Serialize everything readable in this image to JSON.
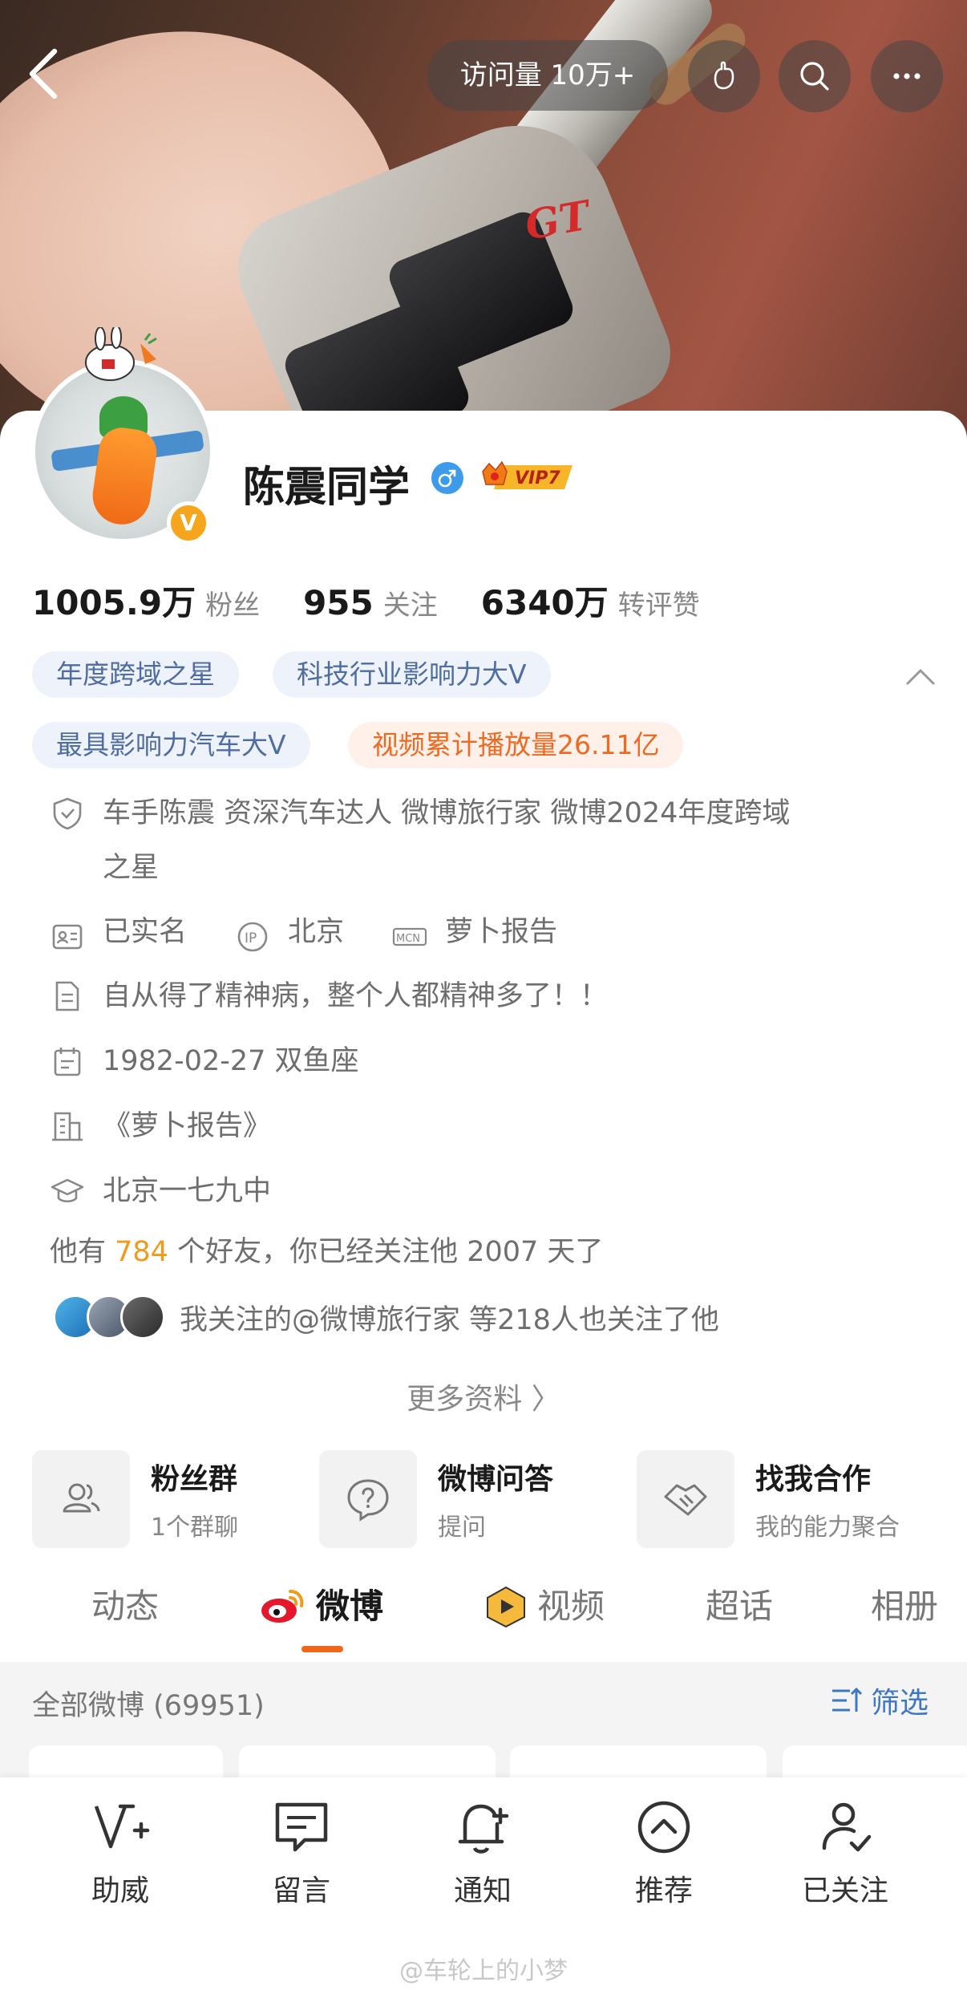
{
  "topbar": {
    "visits_label": "访问量 10万+",
    "icons": [
      "back-arrow-icon",
      "gift-hand-icon",
      "search-icon",
      "more-dots-icon"
    ]
  },
  "profile": {
    "name": "陈震同学",
    "verified_badge": "V",
    "vip_label": "VIP7",
    "gender": "male"
  },
  "stats": [
    {
      "num": "1005.9万",
      "label": "粉丝"
    },
    {
      "num": "955",
      "label": "关注"
    },
    {
      "num": "6340万",
      "label": "转评赞"
    }
  ],
  "tags": {
    "t1": "年度跨域之星",
    "t2": "科技行业影响力大V",
    "t3": "最具影响力汽车大V",
    "t4": "视频累计播放量26.11亿"
  },
  "info": {
    "verification": "车手陈震 资深汽车达人  微博旅行家 微博2024年度跨域",
    "verification_cont": "之星",
    "real_name": "已实名",
    "ip": "北京",
    "mcn": "萝卜报告",
    "bio": "自从得了精神病，整个人都精神多了！！",
    "birthday": "1982-02-27 双鱼座",
    "company": "《萝卜报告》",
    "school": "北京一七九中"
  },
  "friends": {
    "prefix": "他有 ",
    "count": "784",
    "suffix": " 个好友，你已经关注他 2007 天了"
  },
  "mutual": "我关注的@微博旅行家 等218人也关注了他",
  "more_info": "更多资料 〉",
  "features": [
    {
      "title": "粉丝群",
      "sub": "1个群聊"
    },
    {
      "title": "微博问答",
      "sub": "提问"
    },
    {
      "title": "找我合作",
      "sub": "我的能力聚合"
    }
  ],
  "tabs": [
    "动态",
    "微博",
    "视频",
    "超话",
    "相册"
  ],
  "active_tab": "微博",
  "weibo_filter": {
    "all_label": "全部微博 (69951)",
    "filter_label": "筛选"
  },
  "bottom_bar": [
    {
      "label": "助威",
      "icon": "cheer-v-icon"
    },
    {
      "label": "留言",
      "icon": "message-icon"
    },
    {
      "label": "通知",
      "icon": "bell-add-icon"
    },
    {
      "label": "推荐",
      "icon": "recommend-up-icon"
    },
    {
      "label": "已关注",
      "icon": "user-check-icon"
    }
  ],
  "watermark": "@车轮上的小梦",
  "colors": {
    "accent_orange": "#f0661a",
    "link_blue": "#3e77c4",
    "tag_blue_text": "#4f6da0",
    "tag_orange_text": "#ee6a23",
    "highlight": "#f39a1d"
  }
}
